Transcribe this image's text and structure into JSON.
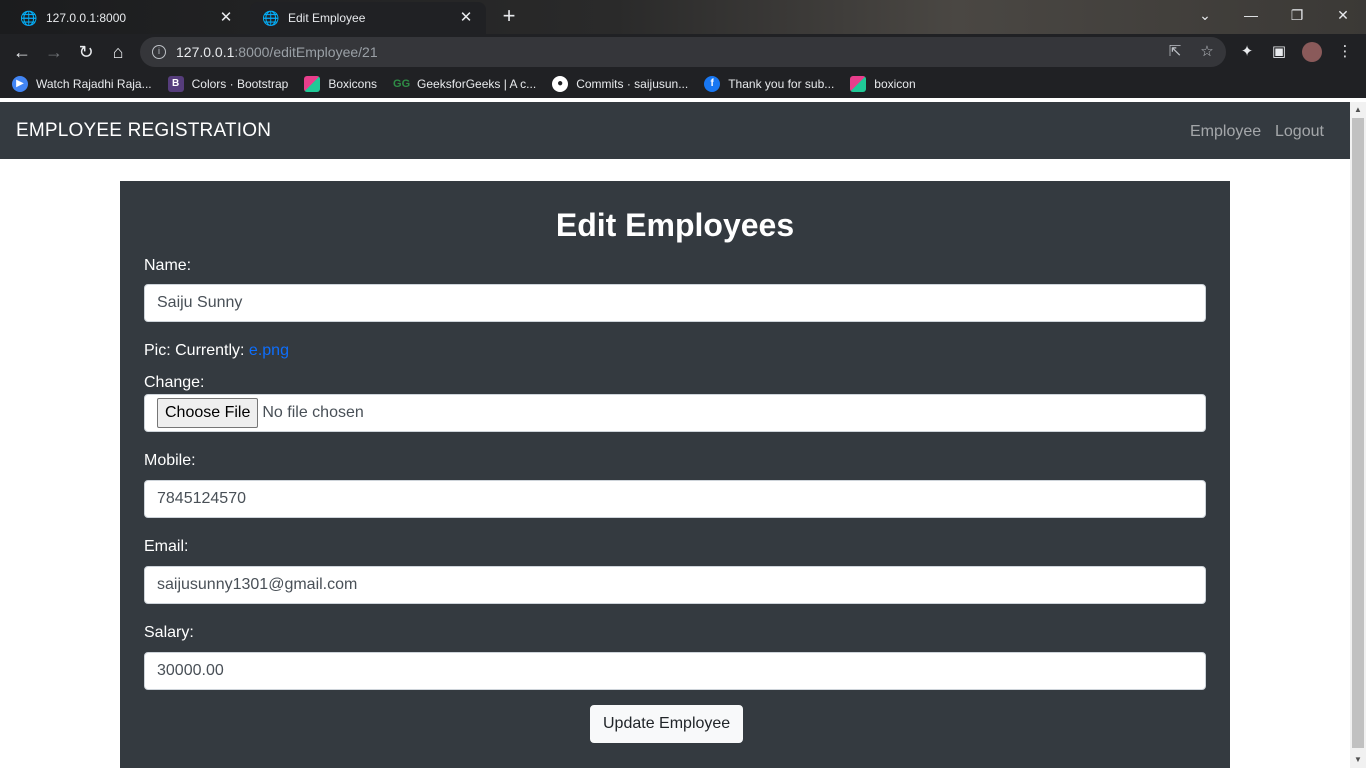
{
  "browser": {
    "tabs": [
      {
        "title": "127.0.0.1:8000",
        "active": false
      },
      {
        "title": "Edit Employee",
        "active": true
      }
    ],
    "url_host": "127.0.0.1",
    "url_path": ":8000/editEmployee/21",
    "bookmarks": [
      {
        "label": "Watch Rajadhi Raja...",
        "icon": "play-icon",
        "color": "#4285f4"
      },
      {
        "label": "Colors · Bootstrap",
        "icon": "bootstrap-icon",
        "color": "#563d7c"
      },
      {
        "label": "Boxicons",
        "icon": "boxicons-icon",
        "color": "#e83e8c"
      },
      {
        "label": "GeeksforGeeks | A c...",
        "icon": "geeksforgeeks-icon",
        "color": "#2f8d46"
      },
      {
        "label": "Commits · saijusun...",
        "icon": "github-icon",
        "color": "#ffffff"
      },
      {
        "label": "Thank you for sub...",
        "icon": "facebook-icon",
        "color": "#1877f2"
      },
      {
        "label": "boxicon",
        "icon": "boxicons-icon",
        "color": "#e83e8c"
      }
    ]
  },
  "navbar": {
    "brand": "EMPLOYEE REGISTRATION",
    "links": [
      "Employee",
      "Logout"
    ]
  },
  "form": {
    "heading": "Edit Employees",
    "name_label": "Name:",
    "name_value": "Saiju Sunny",
    "pic_label": "Pic: Currently:",
    "pic_link": "e.png",
    "change_label": "Change:",
    "choose_file": "Choose File",
    "no_file": "No file chosen",
    "mobile_label": "Mobile:",
    "mobile_value": "7845124570",
    "email_label": "Email:",
    "email_value": "saijusunny1301@gmail.com",
    "salary_label": "Salary:",
    "salary_value": "30000.00",
    "submit_label": "Update Employee"
  },
  "colors": {
    "navbar_bg": "#343a40",
    "card_bg": "#343a40",
    "link": "#0d6efd"
  }
}
